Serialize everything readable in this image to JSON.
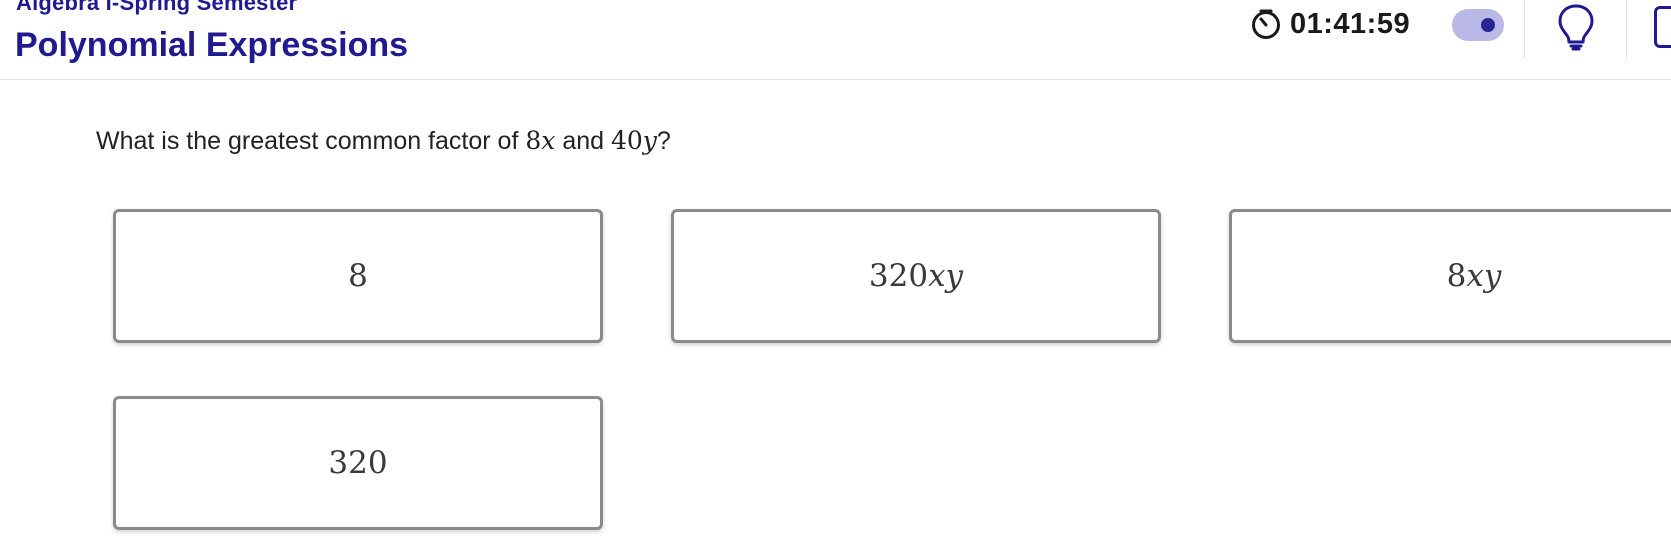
{
  "header": {
    "course_title": "Algebra I-Spring Semester",
    "page_title": "Polynomial Expressions",
    "timer": {
      "time": "01:41:59",
      "icon": "stopwatch-icon"
    },
    "toggle": {
      "on": true
    },
    "hint_icon": "lightbulb-icon",
    "panel_icon": "panel-icon"
  },
  "question": {
    "prefix": "What is the greatest common factor of ",
    "term1_coef": "8",
    "term1_var": "x",
    "joiner": " and ",
    "term2_coef": "40",
    "term2_var": "y",
    "suffix": "?"
  },
  "choices": [
    {
      "id": "a",
      "coef": "8",
      "vars": ""
    },
    {
      "id": "b",
      "coef": "320",
      "vars": "xy"
    },
    {
      "id": "c",
      "coef": "8",
      "vars": "xy"
    },
    {
      "id": "d",
      "coef": "320",
      "vars": ""
    }
  ],
  "colors": {
    "brand": "#1f1a8f",
    "toggle_track": "#b9b8e6",
    "toggle_knob": "#2a2596",
    "choice_border": "#8a8a8a"
  }
}
